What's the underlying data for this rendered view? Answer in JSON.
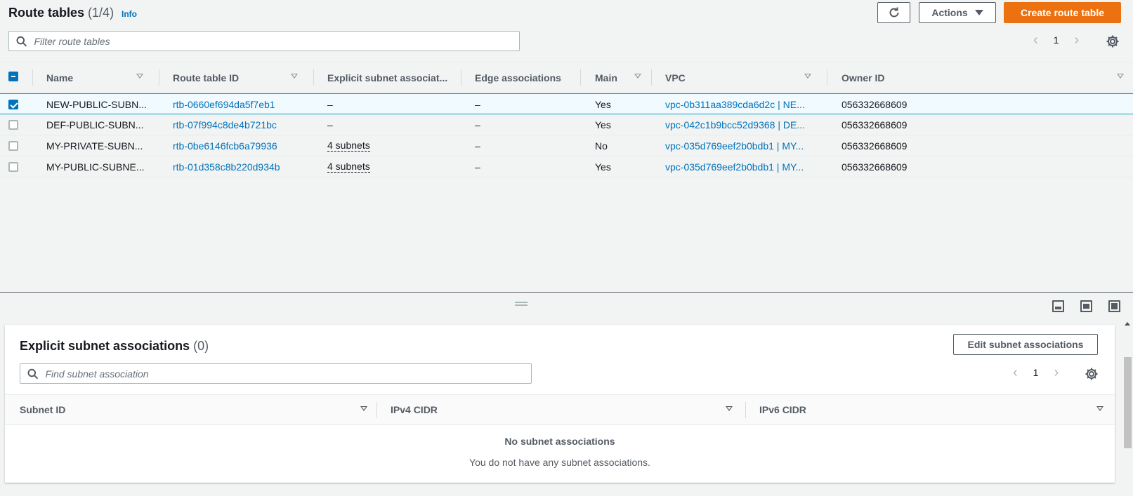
{
  "route_tables": {
    "title": "Route tables",
    "count": "(1/4)",
    "info": "Info",
    "actions_label": "Actions",
    "create_label": "Create route table",
    "search_placeholder": "Filter route tables",
    "page": "1",
    "columns": [
      "Name",
      "Route table ID",
      "Explicit subnet associat...",
      "Edge associations",
      "Main",
      "VPC",
      "Owner ID"
    ],
    "rows": [
      {
        "selected": true,
        "name": "NEW-PUBLIC-SUBN...",
        "id": "rtb-0660ef694da5f7eb1",
        "explicit": "–",
        "edge": "–",
        "main": "Yes",
        "vpc": "vpc-0b311aa389cda6d2c | NE...",
        "owner": "056332668609"
      },
      {
        "selected": false,
        "name": "DEF-PUBLIC-SUBN...",
        "id": "rtb-07f994c8de4b721bc",
        "explicit": "–",
        "edge": "–",
        "main": "Yes",
        "vpc": "vpc-042c1b9bcc52d9368 | DE...",
        "owner": "056332668609"
      },
      {
        "selected": false,
        "name": "MY-PRIVATE-SUBN...",
        "id": "rtb-0be6146fcb6a79936",
        "explicit": "4 subnets",
        "edge": "–",
        "main": "No",
        "vpc": "vpc-035d769eef2b0bdb1 | MY...",
        "owner": "056332668609"
      },
      {
        "selected": false,
        "name": "MY-PUBLIC-SUBNE...",
        "id": "rtb-01d358c8b220d934b",
        "explicit": "4 subnets",
        "edge": "–",
        "main": "Yes",
        "vpc": "vpc-035d769eef2b0bdb1 | MY...",
        "owner": "056332668609"
      }
    ]
  },
  "details": {
    "title": "Explicit subnet associations",
    "count": "(0)",
    "edit_label": "Edit subnet associations",
    "search_placeholder": "Find subnet association",
    "page": "1",
    "columns": [
      "Subnet ID",
      "IPv4 CIDR",
      "IPv6 CIDR"
    ],
    "empty_title": "No subnet associations",
    "empty_desc": "You do not have any subnet associations."
  },
  "colors": {
    "primary": "#ec7211",
    "link": "#0073bb",
    "selected_row": "#f1faff"
  }
}
